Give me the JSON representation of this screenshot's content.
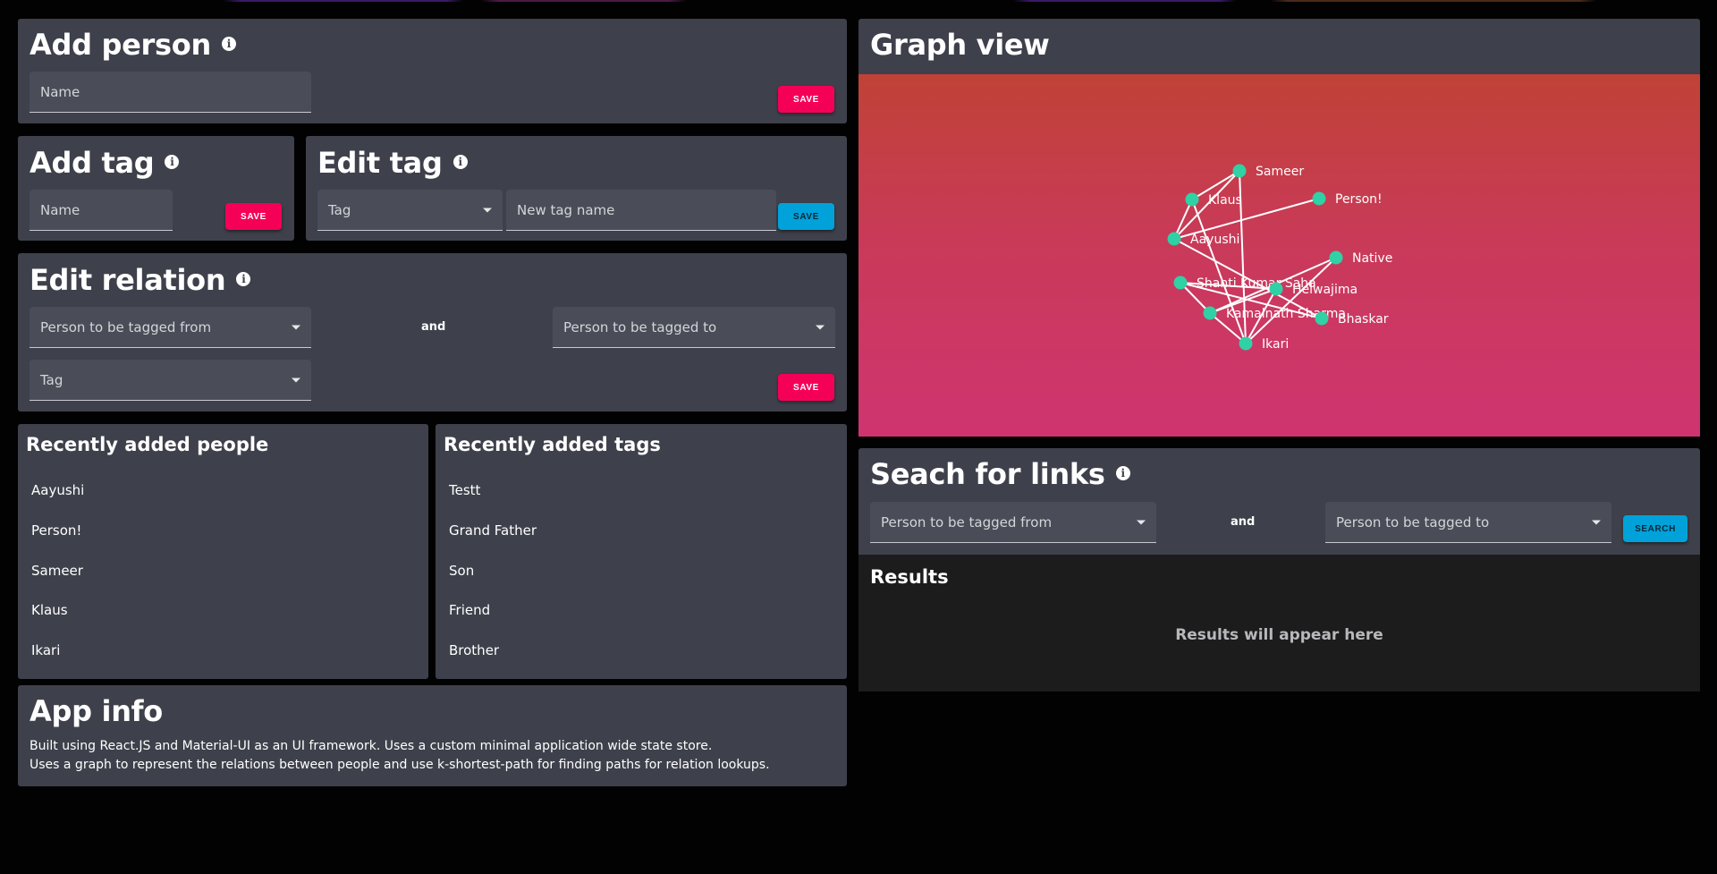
{
  "add_person": {
    "title": "Add person",
    "name_placeholder": "Name",
    "save_label": "SAVE"
  },
  "add_tag": {
    "title": "Add tag",
    "name_placeholder": "Name",
    "save_label": "SAVE"
  },
  "edit_tag": {
    "title": "Edit tag",
    "tag_placeholder": "Tag",
    "new_name_placeholder": "New tag name",
    "save_label": "SAVE"
  },
  "edit_relation": {
    "title": "Edit relation",
    "from_placeholder": "Person to be tagged from",
    "and_label": "and",
    "to_placeholder": "Person to be tagged to",
    "tag_placeholder": "Tag",
    "save_label": "SAVE"
  },
  "recent_people": {
    "title": "Recently added people",
    "items": [
      "Aayushi",
      "Person!",
      "Sameer",
      "Klaus",
      "Ikari"
    ]
  },
  "recent_tags": {
    "title": "Recently added tags",
    "items": [
      "Testt",
      "Grand Father",
      "Son",
      "Friend",
      "Brother"
    ]
  },
  "app_info": {
    "title": "App info",
    "line1": "Built using React.JS and Material-UI as an UI framework. Uses a custom minimal application wide state store.",
    "line2": "Uses a graph to represent the relations between people and use k-shortest-path for finding paths for relation lookups."
  },
  "graph_view": {
    "title": "Graph view",
    "nodes": [
      "Sameer",
      "Klaus",
      "Person!",
      "Aayushi",
      "Native",
      "Shanti Kumar Saha",
      "Helwajima",
      "Kamalnath Sharma",
      "Bhaskar",
      "Ikari"
    ],
    "node_color": "#2fd1a5",
    "edge_color": "#ffffff"
  },
  "search_links": {
    "title": "Seach for links",
    "from_placeholder": "Person to be tagged from",
    "and_label": "and",
    "to_placeholder": "Person to be tagged to",
    "search_label": "SEARCH"
  },
  "results": {
    "title": "Results",
    "empty_message": "Results will appear here"
  },
  "colors": {
    "background": "#020203",
    "card": "#3e414b",
    "pink_accent": "#f50057",
    "blue_accent": "#00a2d9"
  }
}
